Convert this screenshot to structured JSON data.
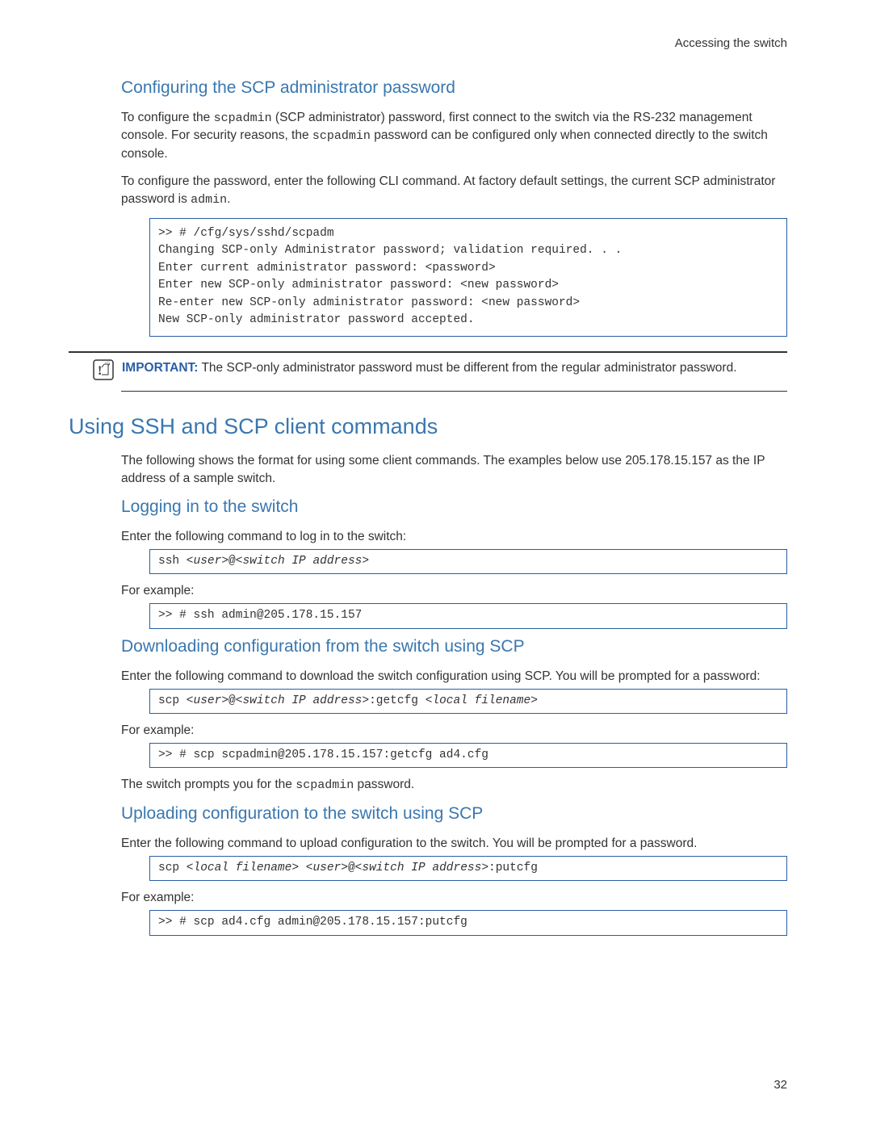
{
  "header": {
    "chapter": "Accessing the switch"
  },
  "sections": {
    "config_scp": {
      "title": "Configuring the SCP administrator password",
      "p1a": "To configure the ",
      "p1_code1": "scpadmin",
      "p1b": " (SCP administrator) password, first connect to the switch via the RS-232 management console. For security reasons, the ",
      "p1_code2": "scpadmin",
      "p1c": " password can be configured only when connected directly to the switch console.",
      "p2a": "To configure the password, enter the following CLI command. At factory default settings, the current SCP administrator password is ",
      "p2_code1": "admin",
      "p2b": ".",
      "code1": ">> # /cfg/sys/sshd/scpadm\nChanging SCP-only Administrator password; validation required. . .\nEnter current administrator password: <password>\nEnter new SCP-only administrator password: <new password>\nRe-enter new SCP-only administrator password: <new password>\nNew SCP-only administrator password accepted.",
      "important_label": "IMPORTANT:",
      "important_text": " The SCP-only administrator password must be different from the regular administrator password."
    },
    "using_ssh": {
      "title": "Using SSH and SCP client commands",
      "intro": "The following shows the format for using some client commands. The examples below use 205.178.15.157 as the IP address of a sample switch."
    },
    "logging_in": {
      "title": "Logging in to the switch",
      "p1": "Enter the following command to log in to the switch:",
      "code1a": "ssh <",
      "code1b": "user",
      "code1c": ">@<",
      "code1d": "switch IP address",
      "code1e": ">",
      "p2": "For example:",
      "code2": ">> # ssh admin@205.178.15.157"
    },
    "downloading": {
      "title": "Downloading configuration from the switch using SCP",
      "p1": "Enter the following command to download the switch configuration using SCP. You will be prompted for a password:",
      "code1a": "scp <",
      "code1b": "user",
      "code1c": ">@<",
      "code1d": "switch IP address",
      "code1e": ">:getcfg <",
      "code1f": "local filename",
      "code1g": ">",
      "p2": "For example:",
      "code2": ">> # scp scpadmin@205.178.15.157:getcfg ad4.cfg",
      "p3a": "The switch prompts you for the ",
      "p3_code": "scpadmin",
      "p3b": " password."
    },
    "uploading": {
      "title": "Uploading configuration to the switch using SCP",
      "p1": "Enter the following command to upload configuration to the switch. You will be prompted for a password.",
      "code1a": "scp <",
      "code1b": "local filename",
      "code1c": "> <",
      "code1d": "user",
      "code1e": ">@<",
      "code1f": "switch IP address",
      "code1g": ">:putcfg",
      "p2": "For example:",
      "code2": ">> # scp ad4.cfg admin@205.178.15.157:putcfg"
    }
  },
  "page_number": "32"
}
